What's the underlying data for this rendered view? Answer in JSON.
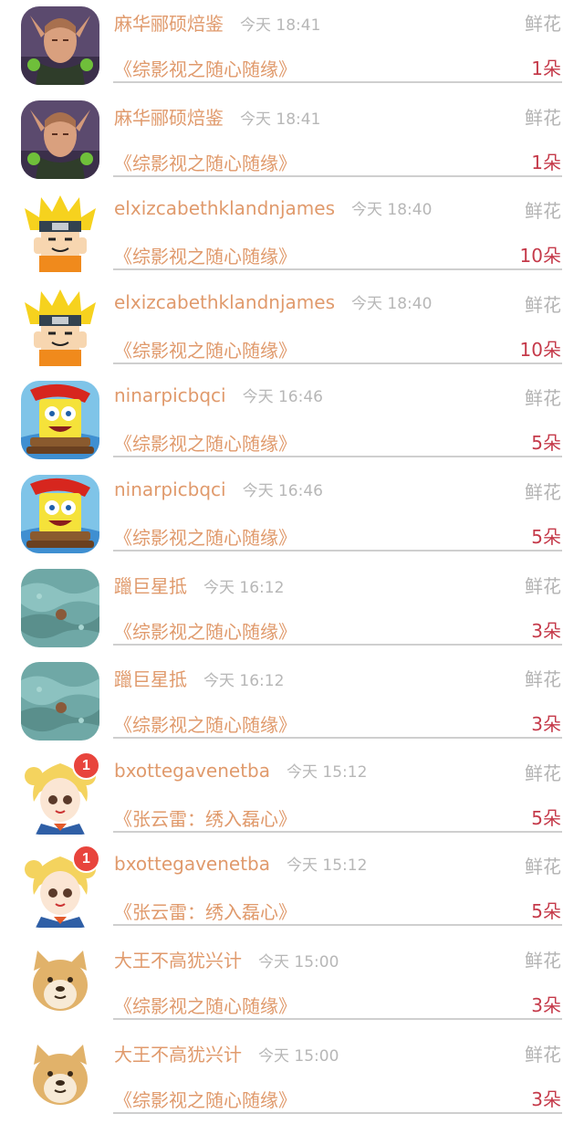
{
  "rows": [
    {
      "user": "麻华郦硕焙鉴",
      "time": "今天 18:41",
      "type": "鲜花",
      "book": "《综影视之随心随缘》",
      "count": "1朵",
      "avatar": "elf-avatar-icon",
      "badge": ""
    },
    {
      "user": "麻华郦硕焙鉴",
      "time": "今天 18:41",
      "type": "鲜花",
      "book": "《综影视之随心随缘》",
      "count": "1朵",
      "avatar": "elf-avatar-icon",
      "badge": ""
    },
    {
      "user": "elxizcabethklandnjames",
      "time": "今天 18:40",
      "type": "鲜花",
      "book": "《综影视之随心随缘》",
      "count": "10朵",
      "avatar": "ninja-avatar-icon",
      "badge": ""
    },
    {
      "user": "elxizcabethklandnjames",
      "time": "今天 18:40",
      "type": "鲜花",
      "book": "《综影视之随心随缘》",
      "count": "10朵",
      "avatar": "ninja-avatar-icon",
      "badge": ""
    },
    {
      "user": "ninarpicbqci",
      "time": "今天 16:46",
      "type": "鲜花",
      "book": "《综影视之随心随缘》",
      "count": "5朵",
      "avatar": "sponge-avatar-icon",
      "badge": ""
    },
    {
      "user": "ninarpicbqci",
      "time": "今天 16:46",
      "type": "鲜花",
      "book": "《综影视之随心随缘》",
      "count": "5朵",
      "avatar": "sponge-avatar-icon",
      "badge": ""
    },
    {
      "user": "躐巨星抵",
      "time": "今天 16:12",
      "type": "鲜花",
      "book": "《综影视之随心随缘》",
      "count": "3朵",
      "avatar": "sea-avatar-icon",
      "badge": ""
    },
    {
      "user": "躐巨星抵",
      "time": "今天 16:12",
      "type": "鲜花",
      "book": "《综影视之随心随缘》",
      "count": "3朵",
      "avatar": "sea-avatar-icon",
      "badge": ""
    },
    {
      "user": "bxottegavenetba",
      "time": "今天 15:12",
      "type": "鲜花",
      "book": "《张云雷：绣入磊心》",
      "count": "5朵",
      "avatar": "anime-girl-avatar-icon",
      "badge": "1"
    },
    {
      "user": "bxottegavenetba",
      "time": "今天 15:12",
      "type": "鲜花",
      "book": "《张云雷：绣入磊心》",
      "count": "5朵",
      "avatar": "anime-girl-avatar-icon",
      "badge": "1"
    },
    {
      "user": "大王不高犹兴计",
      "time": "今天 15:00",
      "type": "鲜花",
      "book": "《综影视之随心随缘》",
      "count": "3朵",
      "avatar": "doge-avatar-icon",
      "badge": ""
    },
    {
      "user": "大王不高犹兴计",
      "time": "今天 15:00",
      "type": "鲜花",
      "book": "《综影视之随心随缘》",
      "count": "3朵",
      "avatar": "doge-avatar-icon",
      "badge": ""
    }
  ],
  "colors": {
    "username": "#e09a6c",
    "time": "#b7b7b7",
    "type": "#b3b3b3",
    "count": "#c53a4a",
    "badge": "#e8443c",
    "divider": "#cfcfcf"
  }
}
